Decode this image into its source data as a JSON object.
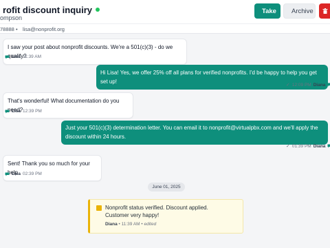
{
  "header": {
    "title": "rofit discount inquiry",
    "subtitle": "ompson",
    "take_label": "Take",
    "archive_label": "Archive",
    "status_color": "#22c55e"
  },
  "contact": {
    "phone": "78888",
    "separator": "•",
    "email": "lisa@nonprofit.org"
  },
  "messages": [
    {
      "direction": "in",
      "text": "I saw your post about nonprofit discounts. We're a 501(c)(3) - do we qualify?",
      "sender": "Lisa",
      "time": "11:39 AM"
    },
    {
      "direction": "out",
      "text": "Hi Lisa! Yes, we offer 25% off all plans for verified nonprofits. I'd be happy to help you get set up!",
      "sender": "Diana",
      "time": "12:09 PM"
    },
    {
      "direction": "in",
      "text": "That's wonderful! What documentation do you need?",
      "sender": "Lisa",
      "time": "12:39 PM"
    },
    {
      "direction": "out",
      "text": "Just your 501(c)(3) determination letter. You can email it to nonprofit@virtualpbx.com and we'll apply the discount within 24 hours.",
      "sender": "Diana",
      "time": "01:39 PM"
    },
    {
      "direction": "in",
      "text": "Sent! Thank you so much for your help.",
      "sender": "Lisa",
      "time": "02:39 PM"
    }
  ],
  "date_divider": "June 01, 2025",
  "note": {
    "text": "Nonprofit status verified. Discount applied.\nCustomer very happy!",
    "author": "Diana",
    "time": "11:39 AM",
    "edited": "edited"
  },
  "colors": {
    "accent": "#0e8f7c",
    "danger": "#dc2626",
    "note_bar": "#eab308"
  }
}
